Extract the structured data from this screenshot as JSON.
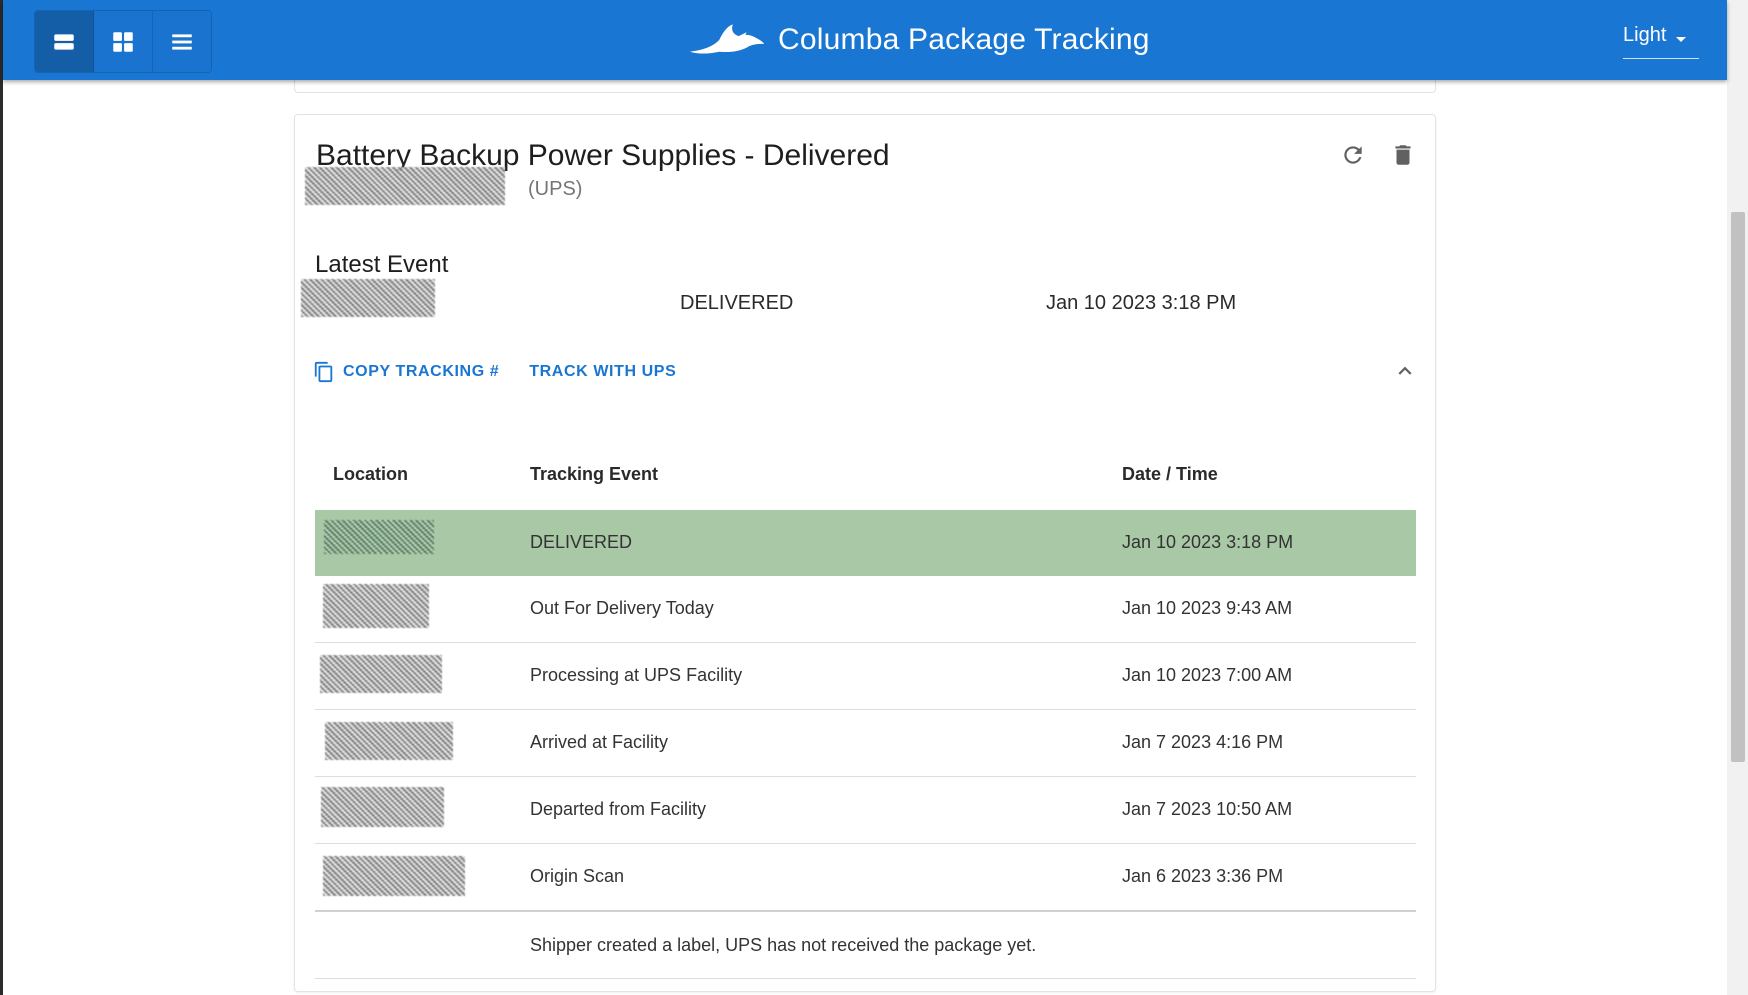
{
  "app": {
    "title": "Columba Package Tracking",
    "theme": "Light",
    "view_modes": [
      "large-cards-icon",
      "grid-icon",
      "list-icon"
    ],
    "accent_color": "#1976d2"
  },
  "package": {
    "title": "Battery Backup Power Supplies - Delivered",
    "carrier": "(UPS)",
    "latest_event_label": "Latest Event",
    "latest_event": {
      "status": "DELIVERED",
      "datetime": "Jan 10 2023 3:18 PM"
    },
    "actions": {
      "copy": "COPY TRACKING #",
      "track": "TRACK WITH UPS"
    }
  },
  "events_table": {
    "headers": [
      "Location",
      "Tracking Event",
      "Date / Time"
    ],
    "rows": [
      {
        "event": "DELIVERED",
        "datetime": "Jan 10 2023 3:18 PM"
      },
      {
        "event": "Out For Delivery Today",
        "datetime": "Jan 10 2023 9:43 AM"
      },
      {
        "event": "Processing at UPS Facility",
        "datetime": "Jan 10 2023 7:00 AM"
      },
      {
        "event": "Arrived at Facility",
        "datetime": "Jan 7 2023 4:16 PM"
      },
      {
        "event": "Departed from Facility",
        "datetime": "Jan 7 2023 10:50 AM"
      },
      {
        "event": "Origin Scan",
        "datetime": "Jan 6 2023 3:36 PM"
      }
    ],
    "note": "Shipper created a label, UPS has not received the package yet.",
    "delivered_color": "#a8c8a6"
  }
}
